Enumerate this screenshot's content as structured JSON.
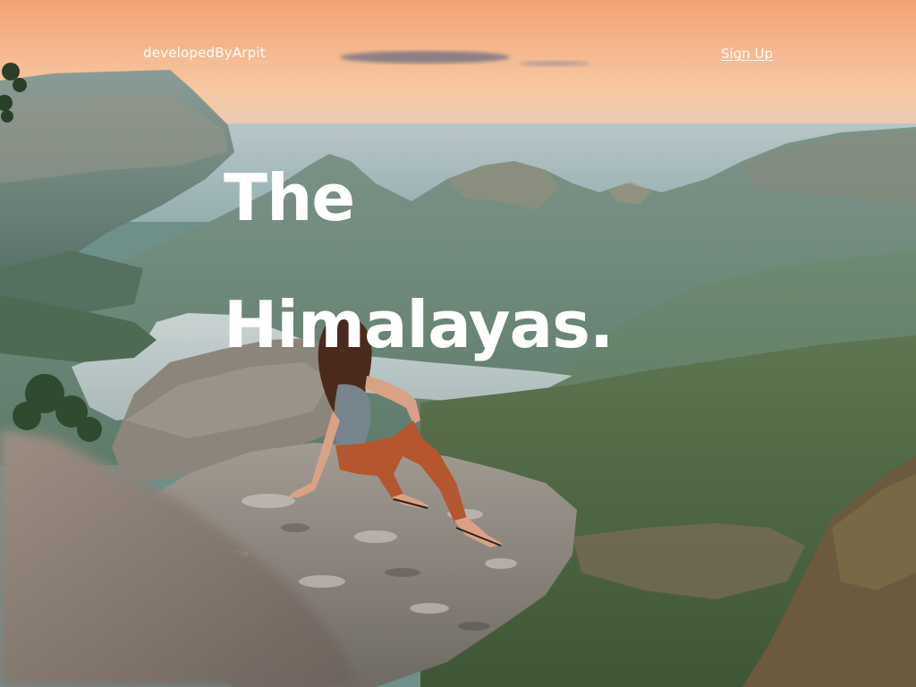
{
  "nav": {
    "brand": "developedByArpit",
    "signup_label": "Sign Up"
  },
  "hero": {
    "line1": "The",
    "line2": "Himalayas."
  },
  "colors": {
    "text": "#ffffff",
    "sky_top": "#f4a878",
    "sky_bottom": "#fbd9b8",
    "mountain": "#5f7f6f",
    "rock": "#8a8580"
  },
  "background": {
    "icon": "mountain-landscape-photo"
  }
}
